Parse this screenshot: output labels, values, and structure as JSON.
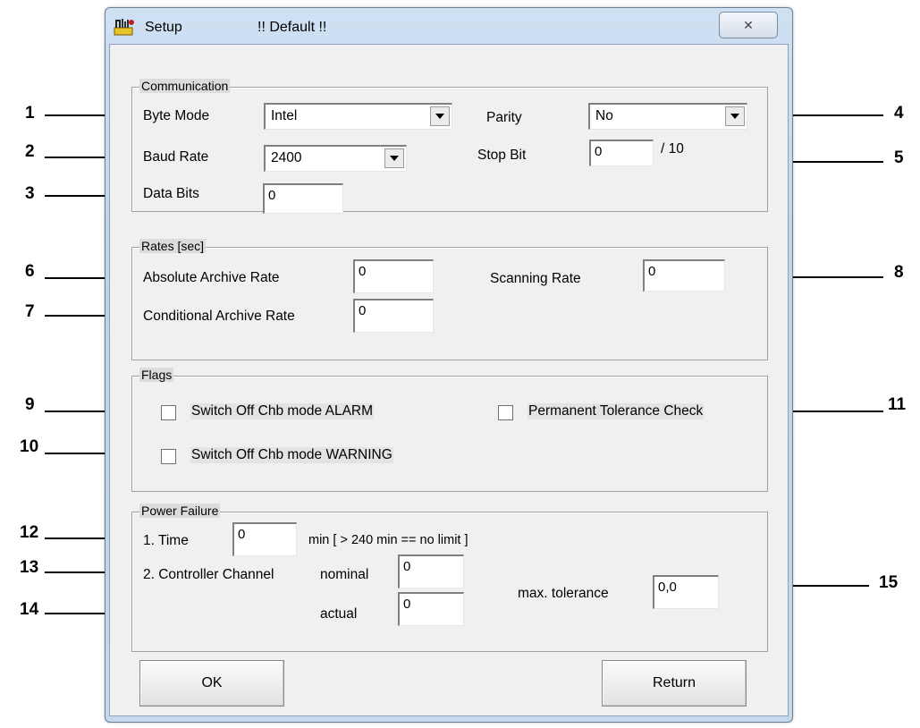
{
  "window": {
    "title": "Setup",
    "subtitle": "!! Default !!",
    "close_glyph": "✕"
  },
  "communication": {
    "title": "Communication",
    "byte_mode": {
      "label": "Byte Mode",
      "value": "Intel"
    },
    "baud_rate": {
      "label": "Baud Rate",
      "value": "2400"
    },
    "data_bits": {
      "label": "Data Bits",
      "value": "0"
    },
    "parity": {
      "label": "Parity",
      "value": "No"
    },
    "stop_bit": {
      "label": "Stop Bit",
      "value": "0",
      "suffix": "/ 10"
    }
  },
  "rates": {
    "title": "Rates [sec]",
    "absolute": {
      "label": "Absolute Archive Rate",
      "value": "0"
    },
    "conditional": {
      "label": "Conditional Archive Rate",
      "value": "0"
    },
    "scanning": {
      "label": "Scanning Rate",
      "value": "0"
    }
  },
  "flags": {
    "title": "Flags",
    "alarm": {
      "label": "Switch Off Chb mode ALARM",
      "checked": false
    },
    "warning": {
      "label": "Switch Off Chb mode WARNING",
      "checked": false
    },
    "tolerance": {
      "label": "Permanent Tolerance Check",
      "checked": false
    }
  },
  "power_failure": {
    "title": "Power Failure",
    "time": {
      "label": "1. Time",
      "value": "0",
      "hint": "min  [ > 240 min == no limit ]"
    },
    "controller_label": "2. Controller Channel",
    "nominal": {
      "label": "nominal",
      "value": "0"
    },
    "actual": {
      "label": "actual",
      "value": "0"
    },
    "max_tolerance": {
      "label": "max. tolerance",
      "value": "0,0"
    }
  },
  "buttons": {
    "ok": "OK",
    "return": "Return"
  },
  "callouts": [
    "1",
    "2",
    "3",
    "4",
    "5",
    "6",
    "7",
    "8",
    "9",
    "10",
    "11",
    "12",
    "13",
    "14",
    "15"
  ],
  "icons": {
    "app": "setup-tools-icon",
    "dropdown": "chevron-down-icon",
    "close": "close-icon"
  }
}
